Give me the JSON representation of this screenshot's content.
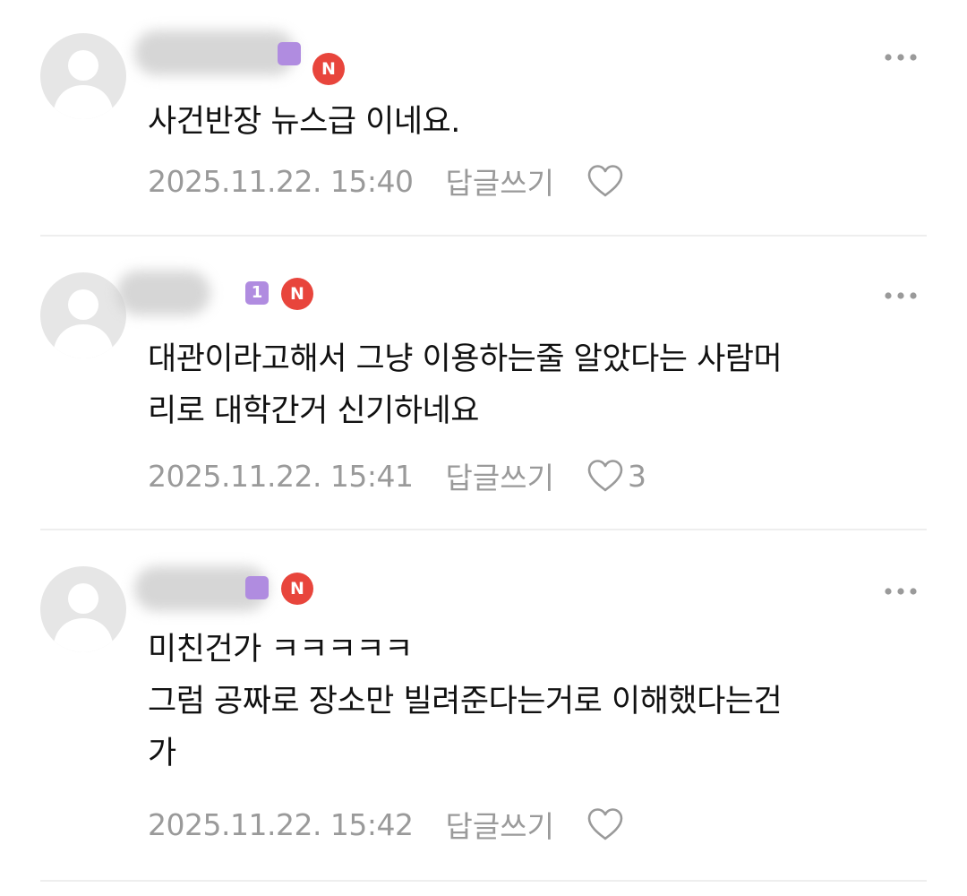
{
  "comments": [
    {
      "text": "사건반장 뉴스급 이네요.",
      "date": "2025.11.22. 15:40",
      "reply_label": "답글쓰기",
      "like_count": "",
      "has_rank_badge": true,
      "rank_badge": "",
      "new_badge": "N"
    },
    {
      "text": "대관이라고해서 그냥 이용하는줄 알았다는 사람머\n리로 대학간거 신기하네요",
      "date": "2025.11.22. 15:41",
      "reply_label": "답글쓰기",
      "like_count": "3",
      "has_rank_badge": true,
      "rank_badge": "1",
      "new_badge": "N"
    },
    {
      "text": "미친건가 ㅋㅋㅋㅋㅋ\n그럼 공짜로 장소만 빌려준다는거로 이해했다는건\n가",
      "date": "2025.11.22. 15:42",
      "reply_label": "답글쓰기",
      "like_count": "",
      "has_rank_badge": true,
      "rank_badge": "",
      "new_badge": "N"
    }
  ],
  "icons": {
    "avatar": "default-user-avatar-icon",
    "more": "more-dots-icon",
    "like": "heart-outline-icon"
  },
  "colors": {
    "rank_badge": "#b08ce0",
    "new_badge": "#e8453c",
    "meta_text": "#9a9a9a",
    "avatar_bg": "#e6e6e6",
    "divider": "#eeeeee"
  }
}
